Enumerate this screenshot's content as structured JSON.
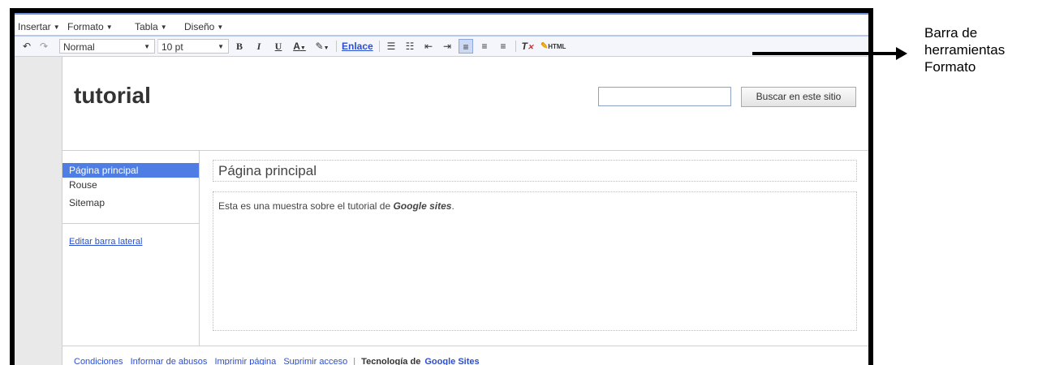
{
  "menu": [
    "Insertar",
    "Formato",
    "Tabla",
    "Diseño"
  ],
  "toolbar": {
    "style_value": "Normal",
    "size_value": "10 pt",
    "link_label": "Enlace",
    "html_label": "HTML",
    "bold": "B",
    "italic": "I",
    "underline": "U",
    "text_color": "A"
  },
  "site": {
    "title": "tutorial",
    "search_button": "Buscar en este sitio"
  },
  "sidebar": {
    "items": [
      "Página principal",
      "Rouse",
      "Sitemap"
    ],
    "edit_link": "Editar barra lateral"
  },
  "content": {
    "title": "Página principal",
    "body_prefix": "Esta es una muestra sobre el tutorial de ",
    "body_bold": "Google sites",
    "body_suffix": "."
  },
  "footer": {
    "links": [
      "Condiciones",
      "Informar de abusos",
      "Imprimir página",
      "Suprimir acceso"
    ],
    "sep": "|",
    "tech_prefix": "Tecnología de",
    "tech_link": "Google Sites"
  },
  "annotation": {
    "line1": "Barra de",
    "line2": "herramientas",
    "line3": "Formato"
  },
  "colors": {
    "accent": "#4e7ee3",
    "link": "#2a4fd0"
  }
}
